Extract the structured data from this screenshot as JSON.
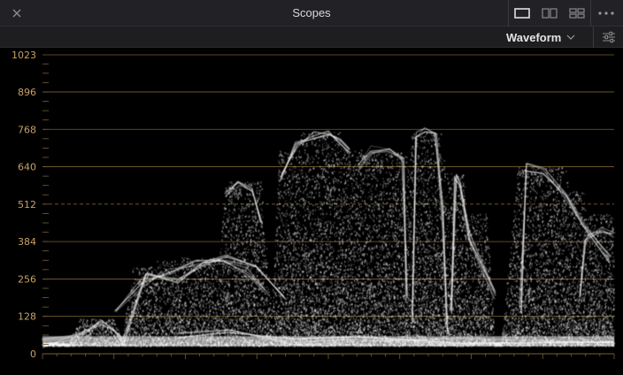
{
  "window": {
    "title": "Scopes",
    "close_icon": "close-icon",
    "layout_icons": [
      "single-layout-icon",
      "dual-layout-icon",
      "quad-layout-icon"
    ],
    "more_icon": "more-icon"
  },
  "toolbar": {
    "mode": "Waveform",
    "dropdown_icon": "chevron-down-icon",
    "settings_icon": "settings-sliders-icon"
  },
  "scope": {
    "y_min": 0,
    "y_max": 1023,
    "y_labels": [
      "1023",
      "896",
      "768",
      "640",
      "512",
      "384",
      "256",
      "128",
      "0"
    ],
    "reference_level": 512,
    "graticule_color": "#7a5f2e",
    "label_color": "#c8a064",
    "trace_color": "#ffffff"
  }
}
